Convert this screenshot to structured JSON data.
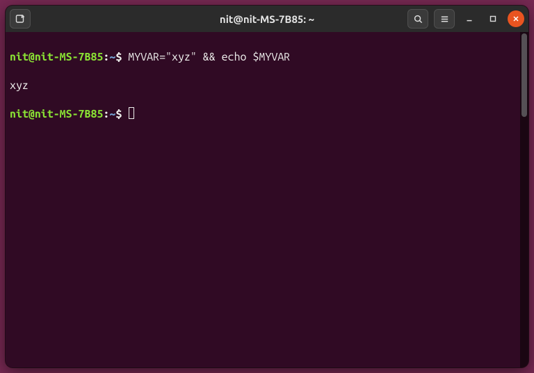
{
  "window": {
    "title": "nit@nit-MS-7B85: ~"
  },
  "prompt": {
    "userhost": "nit@nit-MS-7B85",
    "colon": ":",
    "path": "~",
    "dollar": "$"
  },
  "session": {
    "line1_command": " MYVAR=\"xyz\" && echo $MYVAR",
    "line2_output": "xyz",
    "line3_command": " "
  },
  "icons": {
    "newtab": "new-tab-icon",
    "search": "search-icon",
    "menu": "hamburger-icon",
    "min": "minimize-icon",
    "max": "maximize-icon",
    "close": "close-icon"
  },
  "colors": {
    "bg_desktop": "#772953",
    "bg_terminal": "#300a24",
    "titlebar": "#2b2b2b",
    "close": "#e95420",
    "prompt_user": "#8ae234",
    "prompt_path": "#729fcf",
    "text": "#eeeeec"
  }
}
